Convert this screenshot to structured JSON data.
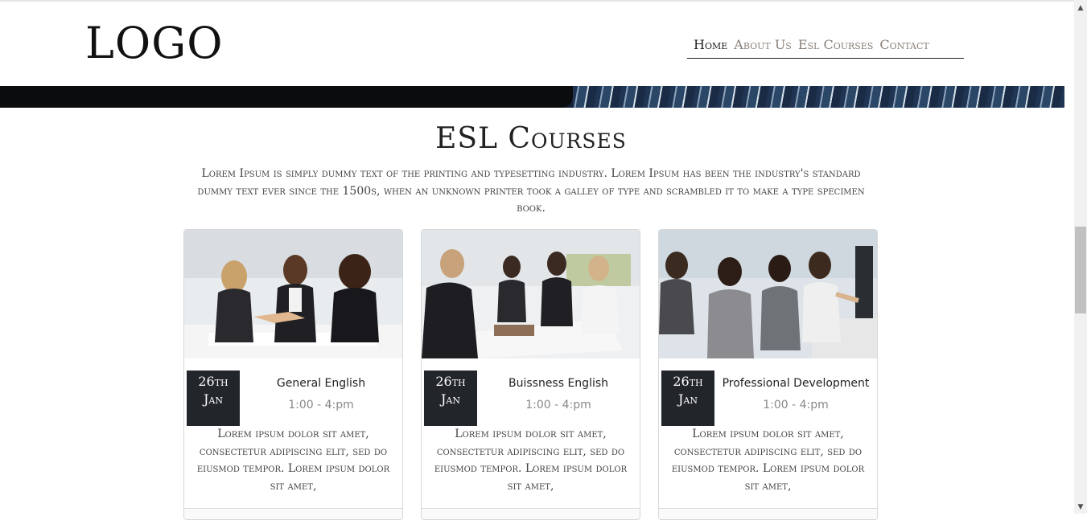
{
  "header": {
    "logo": "LOGO",
    "nav": [
      {
        "label": "Home",
        "active": true
      },
      {
        "label": "About Us",
        "active": false
      },
      {
        "label": "Esl Courses",
        "active": false
      },
      {
        "label": "Contact",
        "active": false
      }
    ]
  },
  "section": {
    "title": "ESL Courses",
    "intro": "Lorem Ipsum is simply dummy text of the printing and typesetting industry. Lorem Ipsum has been the industry's standard dummy text ever since the 1500s, when an unknown printer took a galley of type and scrambled it to make a type specimen book."
  },
  "courses": [
    {
      "image": "two-businesswomen-handshake-photo",
      "day": "26th",
      "month": "Jan",
      "title": "General English",
      "time": "1:00 - 4:pm",
      "description": "Lorem ipsum dolor sit amet, consectetur adipiscing elit, sed do eiusmod tempor. Lorem ipsum dolor sit amet,"
    },
    {
      "image": "women-meeting-table-photo",
      "day": "26th",
      "month": "Jan",
      "title": "Buissness English",
      "time": "1:00 - 4:pm",
      "description": "Lorem ipsum dolor sit amet, consectetur adipiscing elit, sed do eiusmod tempor. Lorem ipsum dolor sit amet,"
    },
    {
      "image": "men-at-computers-photo",
      "day": "26th",
      "month": "Jan",
      "title": "Professional Development",
      "time": "1:00 - 4:pm",
      "description": "Lorem ipsum dolor sit amet, consectetur adipiscing elit, sed do eiusmod tempor. Lorem ipsum dolor sit amet,"
    }
  ],
  "scrollbar": {
    "up_icon": "scroll-up-arrow-icon",
    "down_icon": "scroll-down-arrow-icon"
  }
}
